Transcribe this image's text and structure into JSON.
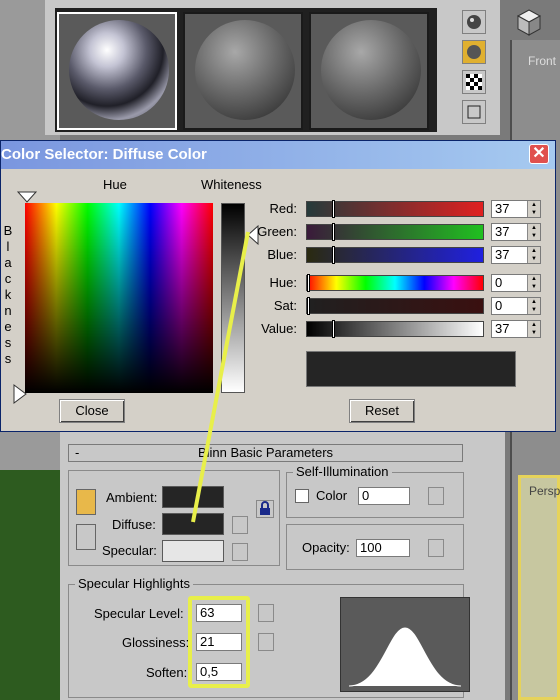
{
  "viewports": {
    "front_label": "Front",
    "persp_label": "Persp"
  },
  "color_selector": {
    "title": "Color Selector: Diffuse Color",
    "hue_label": "Hue",
    "whiteness_label": "Whiteness",
    "blackness_label": "Blackness",
    "channels": [
      {
        "label": "Red:",
        "value": "37"
      },
      {
        "label": "Green:",
        "value": "37"
      },
      {
        "label": "Blue:",
        "value": "37"
      },
      {
        "label": "Hue:",
        "value": "0"
      },
      {
        "label": "Sat:",
        "value": "0"
      },
      {
        "label": "Value:",
        "value": "37"
      }
    ],
    "close_label": "Close",
    "reset_label": "Reset",
    "swatch_color": "#252525"
  },
  "params": {
    "rollout_label": "Blinn Basic Parameters",
    "rollout_toggle": "-",
    "ambient_label": "Ambient:",
    "diffuse_label": "Diffuse:",
    "specular_label": "Specular:",
    "ambient_color": "#252525",
    "diffuse_color": "#252525",
    "specular_color": "#e6e6e6",
    "self_illum_title": "Self-Illumination",
    "color_label": "Color",
    "color_value": "0",
    "opacity_label": "Opacity:",
    "opacity_value": "100",
    "spec_highlights_title": "Specular Highlights",
    "spec_level_label": "Specular Level:",
    "spec_level_value": "63",
    "glossiness_label": "Glossiness:",
    "glossiness_value": "21",
    "soften_label": "Soften:",
    "soften_value": "0,5"
  },
  "accent": {
    "highlight": "#e8ef4a",
    "title_bar": "#7a96df"
  }
}
